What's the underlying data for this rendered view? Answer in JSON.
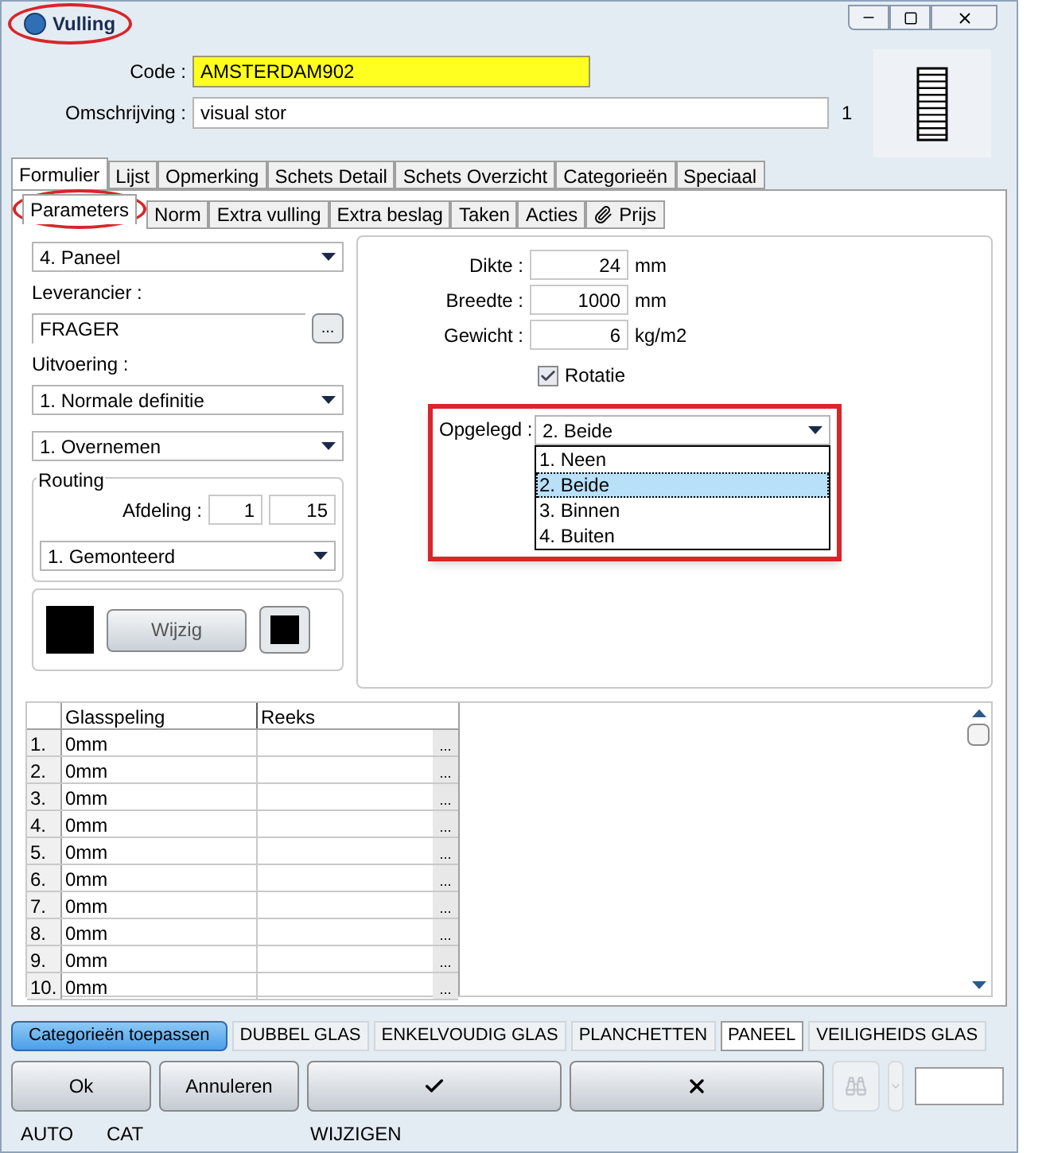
{
  "window": {
    "title": "Vulling"
  },
  "header": {
    "code": {
      "label": "Code :",
      "value": "AMSTERDAM902"
    },
    "omschrijving": {
      "label": "Omschrijving :",
      "value": "visual stor",
      "count": "1"
    }
  },
  "tabs": [
    {
      "label": "Formulier",
      "selected": true
    },
    {
      "label": "Lijst",
      "selected": false
    },
    {
      "label": "Opmerking",
      "selected": false
    },
    {
      "label": "Schets Detail",
      "selected": false
    },
    {
      "label": "Schets Overzicht",
      "selected": false
    },
    {
      "label": "Categorieën",
      "selected": false
    },
    {
      "label": "Speciaal",
      "selected": false
    }
  ],
  "subtabs": [
    {
      "label": "Parameters",
      "selected": true,
      "kind": "plain"
    },
    {
      "label": "Norm",
      "selected": false,
      "kind": "plain"
    },
    {
      "label": "Extra vulling",
      "selected": false,
      "kind": "plain"
    },
    {
      "label": "Extra beslag",
      "selected": false,
      "kind": "plain"
    },
    {
      "label": "Taken",
      "selected": false,
      "kind": "plain"
    },
    {
      "label": "Acties",
      "selected": false,
      "kind": "plain"
    },
    {
      "label": "Prijs",
      "selected": false,
      "kind": "attachment"
    }
  ],
  "left": {
    "type_select": "4.  Paneel",
    "leverancier": {
      "label": "Leverancier :",
      "value": "FRAGER",
      "button": "..."
    },
    "uitvoering": {
      "label": "Uitvoering :",
      "value": "1.  Normale definitie"
    },
    "overnemen": "1.  Overnemen",
    "routing": {
      "title": "Routing",
      "afdeling_label": "Afdeling :",
      "afdeling_1": "1",
      "afdeling_2": "15",
      "select": "1.  Gemonteerd"
    },
    "wijzig": "Wijzig"
  },
  "right": {
    "fields": [
      {
        "label": "Dikte :",
        "value": "24",
        "unit": "mm"
      },
      {
        "label": "Breedte :",
        "value": "1000",
        "unit": "mm"
      },
      {
        "label": "Gewicht :",
        "value": "6",
        "unit": "kg/m2"
      }
    ],
    "rotatie": {
      "label": "Rotatie",
      "checked": true
    },
    "opgelegd": {
      "label": "Opgelegd :",
      "value": "2.  Beide",
      "expanded": true,
      "options": [
        {
          "label": "1.  Neen",
          "selected": false
        },
        {
          "label": "2.  Beide",
          "selected": true
        },
        {
          "label": "3.  Binnen",
          "selected": false
        },
        {
          "label": "4.  Buiten",
          "selected": false
        }
      ]
    }
  },
  "grid": {
    "columns": [
      "Glasspeling",
      "Reeks"
    ],
    "rows": [
      {
        "number": "1.",
        "glasspeling": "0mm",
        "button": "..."
      },
      {
        "number": "2.",
        "glasspeling": "0mm",
        "button": "..."
      },
      {
        "number": "3.",
        "glasspeling": "0mm",
        "button": "..."
      },
      {
        "number": "4.",
        "glasspeling": "0mm",
        "button": "..."
      },
      {
        "number": "5.",
        "glasspeling": "0mm",
        "button": "..."
      },
      {
        "number": "6.",
        "glasspeling": "0mm",
        "button": "..."
      },
      {
        "number": "7.",
        "glasspeling": "0mm",
        "button": "..."
      },
      {
        "number": "8.",
        "glasspeling": "0mm",
        "button": "..."
      },
      {
        "number": "9.",
        "glasspeling": "0mm",
        "button": "..."
      },
      {
        "number": "10.",
        "glasspeling": "0mm",
        "button": "..."
      }
    ]
  },
  "categories": {
    "apply": "Categorieën toepassen",
    "items": [
      {
        "label": "DUBBEL GLAS",
        "selected": false
      },
      {
        "label": "ENKELVOUDIG GLAS",
        "selected": false
      },
      {
        "label": "PLANCHETTEN",
        "selected": false
      },
      {
        "label": "PANEEL",
        "selected": true
      },
      {
        "label": "VEILIGHEIDS GLAS",
        "selected": false
      }
    ]
  },
  "buttons": [
    {
      "kind": "text",
      "label": "Ok"
    },
    {
      "kind": "text",
      "label": "Annuleren"
    },
    {
      "kind": "confirm"
    },
    {
      "kind": "cancel"
    }
  ],
  "status_bar": [
    "AUTO",
    "CAT",
    "WIJZIGEN"
  ]
}
